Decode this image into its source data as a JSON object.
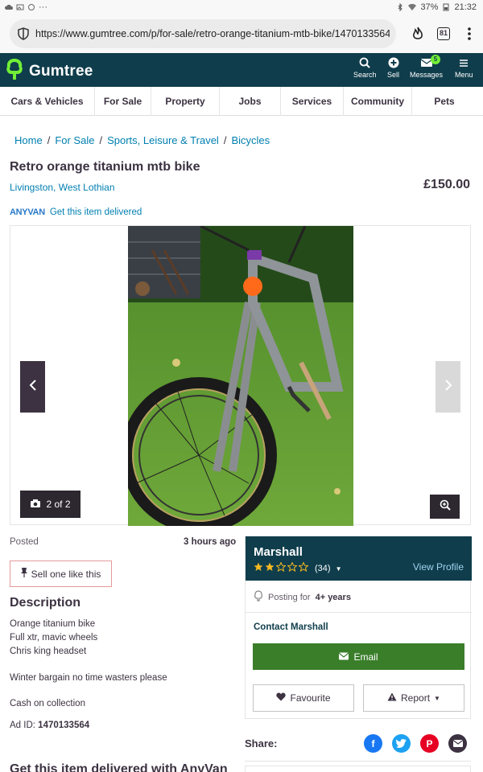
{
  "status_bar": {
    "battery": "37%",
    "time": "21:32",
    "more": "···"
  },
  "browser": {
    "url": "https://www.gumtree.com/p/for-sale/retro-orange-titanium-mtb-bike/1470133564",
    "tab_count": "81"
  },
  "header": {
    "logo": "Gumtree",
    "nav": [
      {
        "label": "Search",
        "icon": "search-icon"
      },
      {
        "label": "Sell",
        "icon": "plus-circle-icon"
      },
      {
        "label": "Messages",
        "icon": "envelope-icon",
        "badge": "5"
      },
      {
        "label": "Menu",
        "icon": "hamburger-icon"
      }
    ]
  },
  "categories": [
    "Cars & Vehicles",
    "For Sale",
    "Property",
    "Jobs",
    "Services",
    "Community",
    "Pets"
  ],
  "breadcrumb": [
    "Home",
    "For Sale",
    "Sports, Leisure & Travel",
    "Bicycles"
  ],
  "listing": {
    "title": "Retro orange titanium mtb bike",
    "location": "Livingston, West Lothian",
    "price": "£150.00",
    "delivery_brand": "ANYVAN",
    "delivery_text": "Get this item delivered"
  },
  "gallery": {
    "counter": "2 of 2",
    "current": 2,
    "total": 2
  },
  "details": {
    "posted_label": "Posted",
    "posted_value": "3 hours ago",
    "sell_label": "Sell one like this",
    "description_title": "Description",
    "description_lines": [
      "Orange titanium bike",
      "Full xtr, mavic wheels",
      "Chris king headset",
      "",
      "Winter bargain no time wasters please",
      "",
      "Cash on collection"
    ],
    "ad_id_label": "Ad ID:",
    "ad_id": "1470133564",
    "promo": "Get this item delivered with AnyVan"
  },
  "seller": {
    "name": "Marshall",
    "rating_stars": 2,
    "rating_max": 5,
    "rating_count": "(34)",
    "view_profile": "View Profile",
    "posting_prefix": "Posting for",
    "posting_duration": "4+ years",
    "contact_label": "Contact Marshall",
    "email_label": "Email",
    "favourite_label": "Favourite",
    "report_label": "Report"
  },
  "share": {
    "label": "Share:"
  },
  "colors": {
    "header_bg": "#0f3d4c",
    "link": "#007fb0",
    "email_button": "#3a7e2a",
    "star": "#f5b921",
    "facebook": "#1877f2",
    "twitter": "#1da1f2",
    "pinterest": "#e60023",
    "email_share": "#3c3241"
  }
}
